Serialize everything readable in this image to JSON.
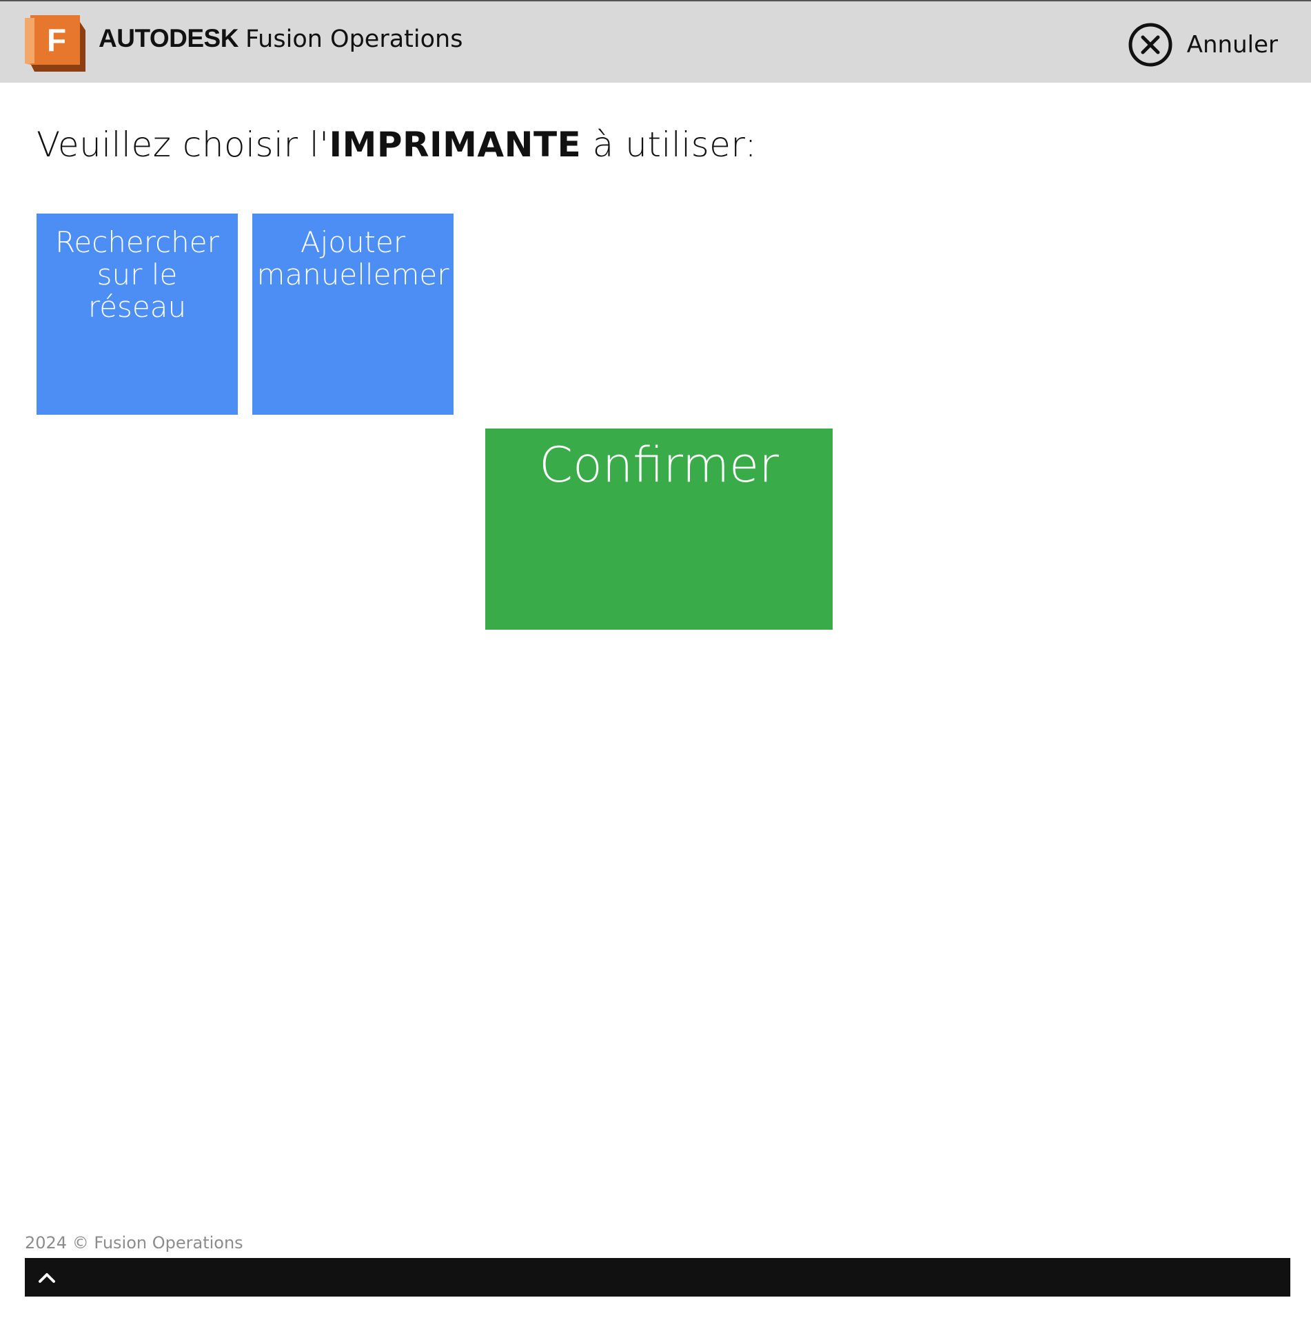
{
  "header": {
    "brand_company": "AUTODESK",
    "brand_product": "Fusion Operations",
    "logo_letter": "F",
    "cancel_label": "Annuler"
  },
  "prompt": {
    "prefix": "Veuillez choisir l'",
    "emphasis": "IMPRIMANTE",
    "suffix": " à utiliser:"
  },
  "tiles": {
    "search_label": "Rechercher\nsur le\nréseau",
    "manual_line1": "Ajouter",
    "manual_line2": "manuellemer"
  },
  "confirm_label": "Confirmer",
  "footer": {
    "copyright": "2024 © Fusion Operations"
  },
  "colors": {
    "header_bg": "#d9d9d9",
    "tile_blue": "#4d8ef5",
    "confirm_green": "#39ab49",
    "logo_orange": "#e8772e",
    "footer_bar": "#111111"
  },
  "icons": {
    "logo": "autodesk-fusion-logo-icon",
    "cancel": "close-circle-icon",
    "footer_toggle": "chevron-up-icon"
  }
}
